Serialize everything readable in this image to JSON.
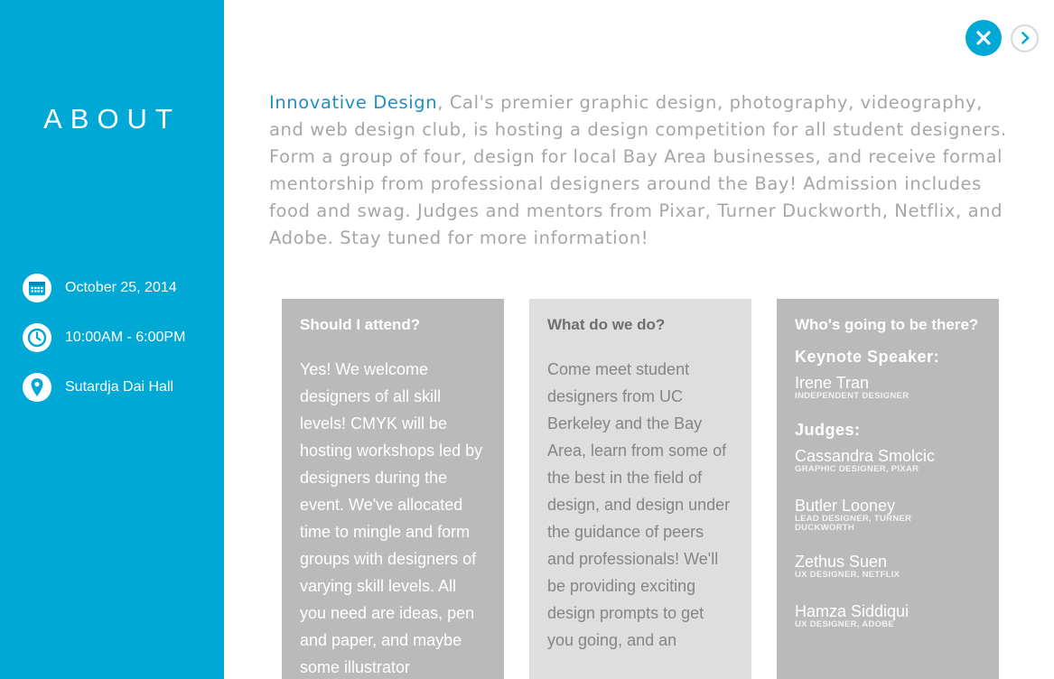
{
  "sidebar": {
    "title": "ABOUT",
    "date": "October 25, 2014",
    "time": "10:00AM - 6:00PM",
    "location": "Sutardja Dai Hall",
    "icons": {
      "date": "calendar-icon",
      "time": "clock-icon",
      "location": "map-pin-icon"
    }
  },
  "controls": {
    "close_icon": "close-icon",
    "next_icon": "chevron-right-icon"
  },
  "intro": {
    "link_text": "Innovative Design",
    "body_text": ", Cal's premier graphic design, photography, videography, and web design club, is hosting a design competition for all student designers. Form a group of four, design for local Bay Area businesses, and receive formal mentorship from professional designers around the Bay! Admission includes food and swag. Judges and mentors from Pixar, Turner Duckworth, Netflix, and Adobe. Stay tuned for more information!"
  },
  "cards": {
    "attend": {
      "title": "Should I attend?",
      "body": "Yes! We welcome designers of all skill levels! CMYK will be hosting workshops led by designers during the event. We've allocated time to mingle and form groups with designers of varying skill levels. All you need are ideas, pen and paper, and maybe some illustrator"
    },
    "what": {
      "title": "What do we do?",
      "body": "Come meet student designers from UC Berkeley and the Bay Area, learn from some of the best in the field of design, and design under the guidance of peers and professionals! We'll be providing exciting design prompts to get you going, and an"
    },
    "who": {
      "title": "Who's going to be there?",
      "keynote_heading": "Keynote Speaker:",
      "keynote": {
        "name": "Irene Tran",
        "role": "INDEPENDENT DESIGNER"
      },
      "judges_heading": "Judges:",
      "judges": [
        {
          "name": "Cassandra Smolcic",
          "role": "GRAPHIC DESIGNER, PIXAR"
        },
        {
          "name": "Butler Looney",
          "role": "LEAD DESIGNER, TURNER DUCKWORTH"
        },
        {
          "name": "Zethus Suen",
          "role": "UX DESIGNER, NETFLIX"
        },
        {
          "name": "Hamza Siddiqui",
          "role": "UX DESIGNER, ADOBE"
        }
      ]
    }
  },
  "colors": {
    "accent": "#00a8d6",
    "card_dark": "#bababa",
    "card_light": "#dedede",
    "text_gray": "#a6a6a6",
    "link": "#1f8fc4"
  }
}
